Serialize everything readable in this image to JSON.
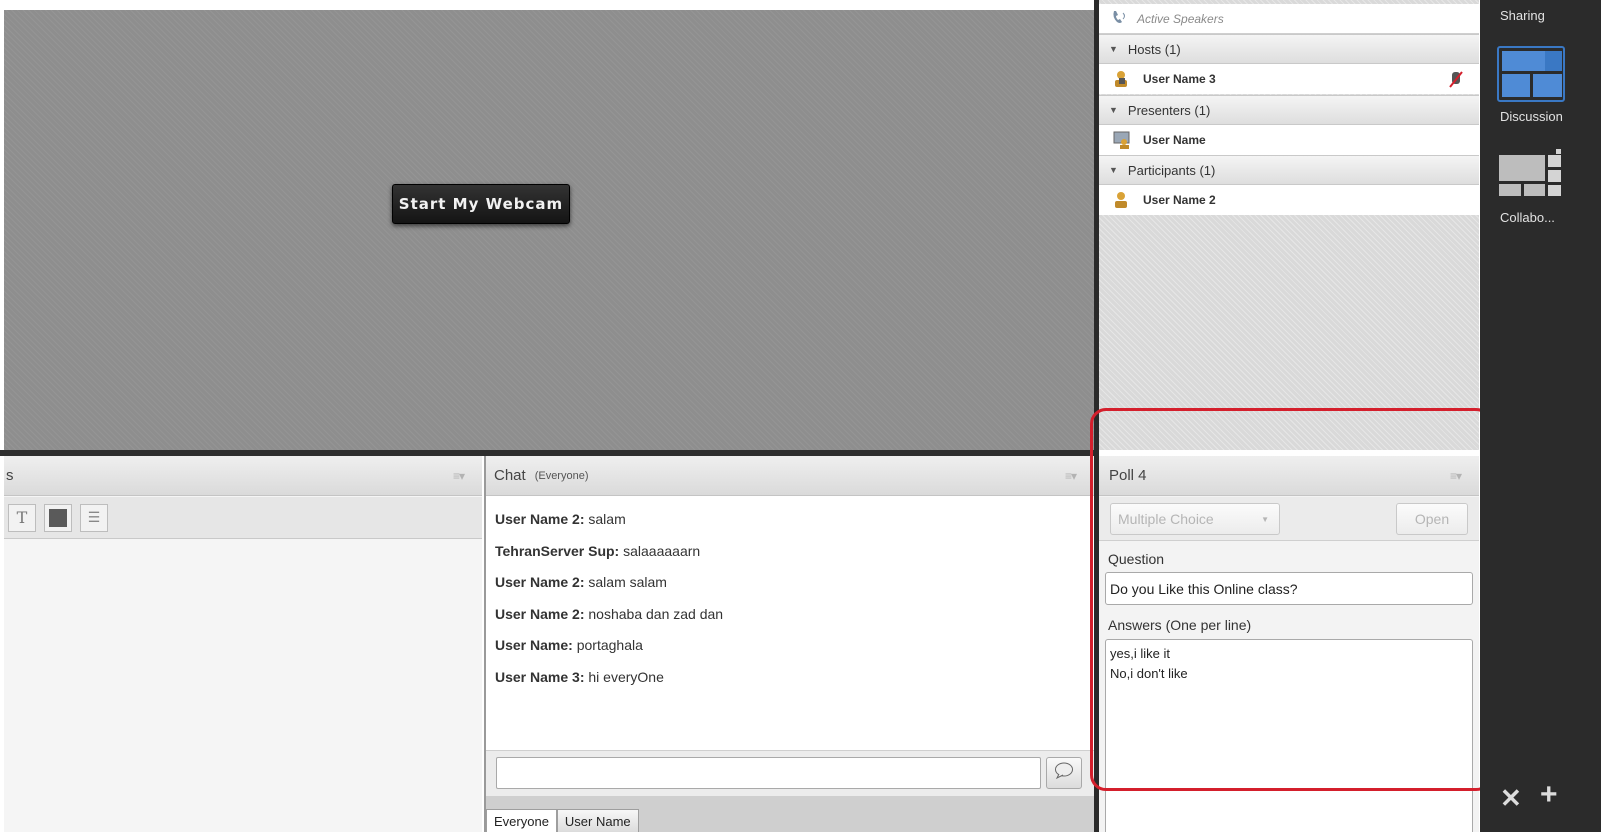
{
  "webcam": {
    "button_label": "Start My Webcam"
  },
  "attendees": {
    "active_speakers": "Active Speakers",
    "groups": [
      {
        "label": "Hosts (1)",
        "users": [
          {
            "name": "User Name 3",
            "mic_muted": true
          }
        ]
      },
      {
        "label": "Presenters (1)",
        "users": [
          {
            "name": "User Name"
          }
        ]
      },
      {
        "label": "Participants (1)",
        "users": [
          {
            "name": "User Name 2"
          }
        ]
      }
    ]
  },
  "notes": {
    "title_fragment": "s"
  },
  "chat": {
    "title": "Chat",
    "scope": "(Everyone)",
    "messages": [
      {
        "sender": "User Name 2:",
        "text": "salam"
      },
      {
        "sender": "TehranServer Sup:",
        "text": "salaaaaaarn"
      },
      {
        "sender": "User Name 2:",
        "text": "salam salam"
      },
      {
        "sender": "User Name 2:",
        "text": "noshaba dan zad dan"
      },
      {
        "sender": "User Name:",
        "text": "portaghala"
      },
      {
        "sender": "User Name 3:",
        "text": "hi everyOne"
      }
    ],
    "input_value": "",
    "tabs": [
      "Everyone",
      "User Name"
    ]
  },
  "poll": {
    "title": "Poll 4",
    "type_selected": "Multiple Choice",
    "open_label": "Open",
    "question_label": "Question",
    "question_value": "Do you Like this Online class?",
    "answers_label": "Answers (One per line)",
    "answers_value": "yes,i like it\nNo,i don't like"
  },
  "layouts": {
    "section_label": "Sharing",
    "items": [
      {
        "label": "Discussion",
        "selected": true
      },
      {
        "label": "Collabo..."
      }
    ]
  },
  "colors": {
    "highlight": "#d41f2c",
    "rail": "#2b2b2b",
    "selected_layout": "#3a78c4"
  }
}
